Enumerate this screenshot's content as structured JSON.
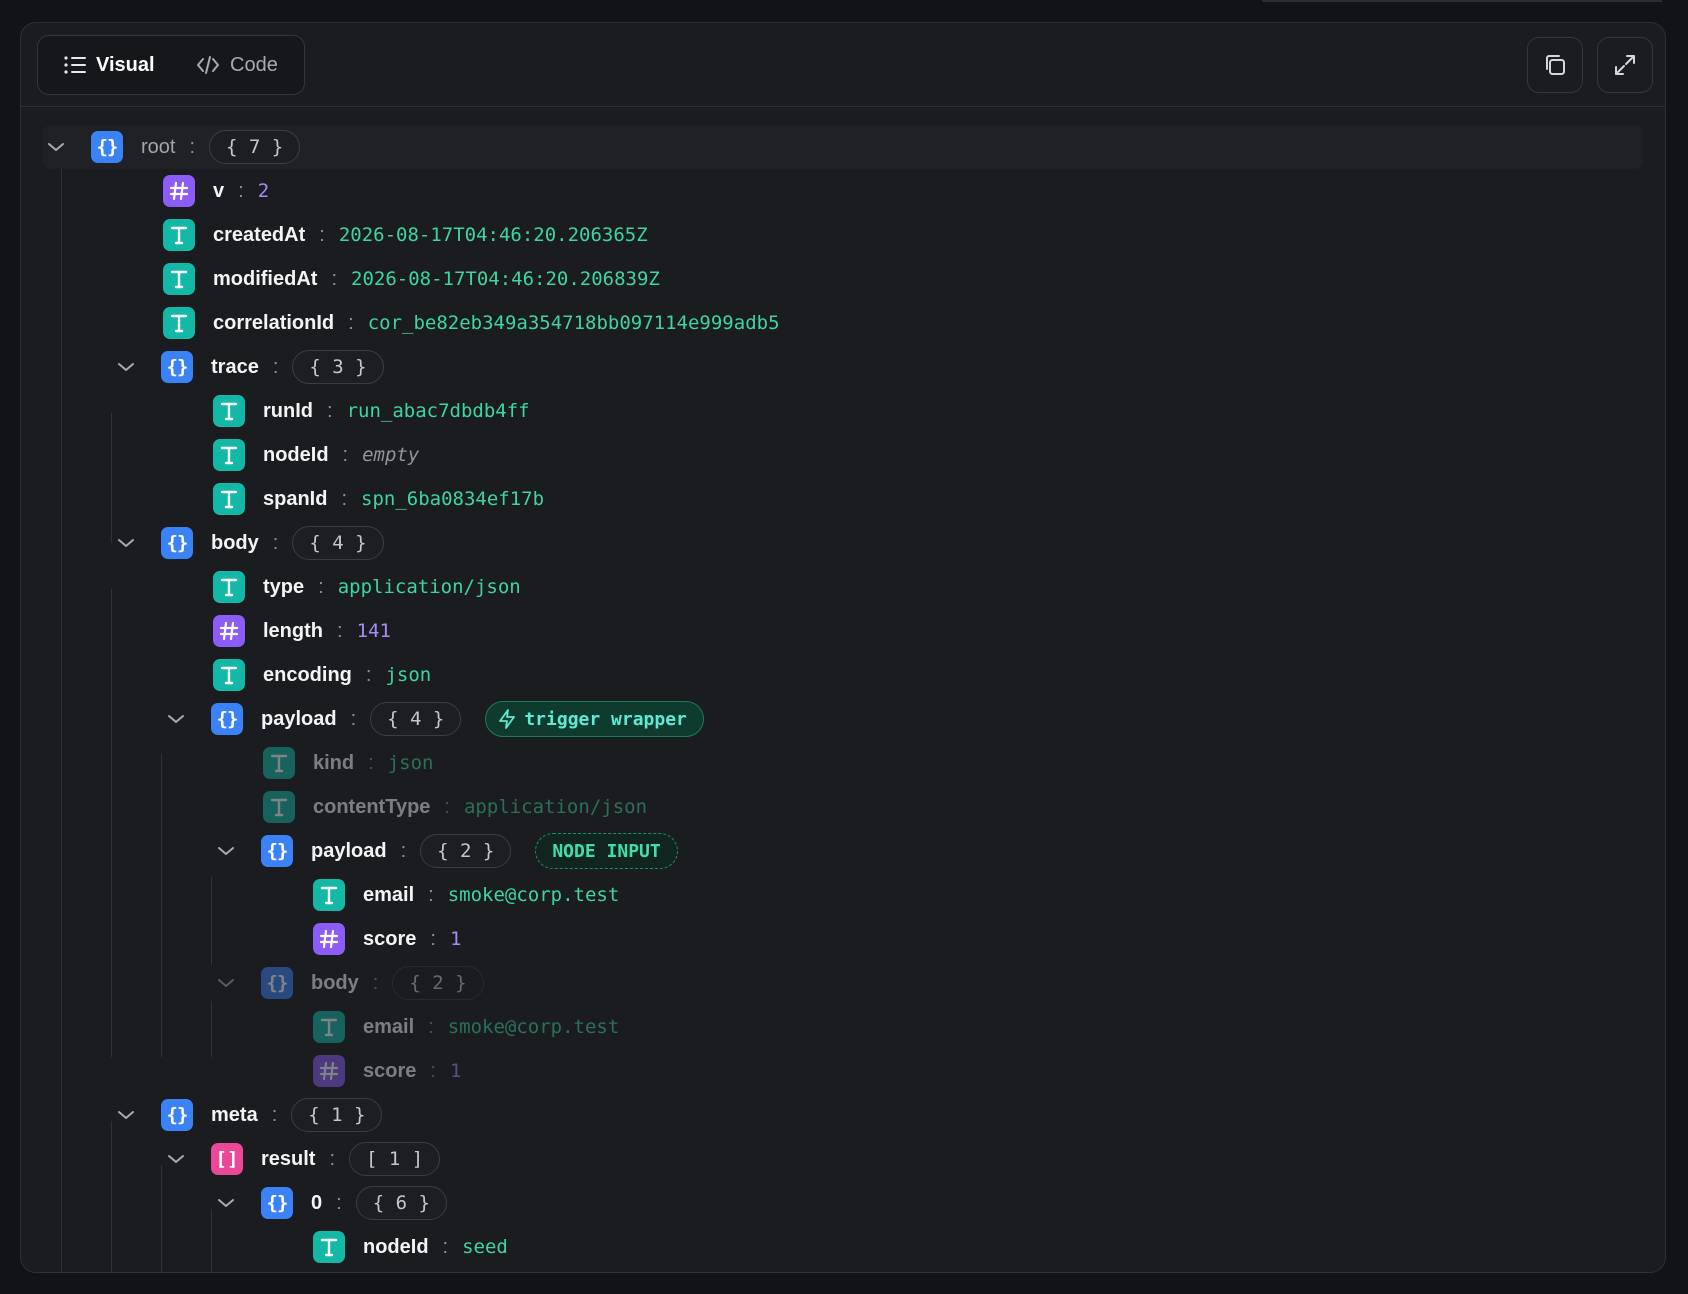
{
  "toolbar": {
    "visual_label": "Visual",
    "code_label": "Code",
    "copy_icon": "copy-icon",
    "expand_icon": "expand-icon"
  },
  "colors": {
    "object": "#3b82f6",
    "string": "#14b8a6",
    "number": "#8b5cf6",
    "array": "#ec4899",
    "string_value": "#3dd5a0",
    "number_value": "#a78bfa"
  },
  "tree": {
    "root": {
      "key": "root",
      "count": "{ 7 }"
    },
    "v": {
      "key": "v",
      "value": "2"
    },
    "createdAt": {
      "key": "createdAt",
      "value": "2026-08-17T04:46:20.206365Z"
    },
    "modifiedAt": {
      "key": "modifiedAt",
      "value": "2026-08-17T04:46:20.206839Z"
    },
    "correlationId": {
      "key": "correlationId",
      "value": "cor_be82eb349a354718bb097114e999adb5"
    },
    "trace": {
      "key": "trace",
      "count": "{ 3 }",
      "runId": {
        "key": "runId",
        "value": "run_abac7dbdb4ff"
      },
      "nodeId": {
        "key": "nodeId",
        "value": "empty"
      },
      "spanId": {
        "key": "spanId",
        "value": "spn_6ba0834ef17b"
      }
    },
    "body": {
      "key": "body",
      "count": "{ 4 }",
      "type": {
        "key": "type",
        "value": "application/json"
      },
      "length": {
        "key": "length",
        "value": "141"
      },
      "encoding": {
        "key": "encoding",
        "value": "json"
      },
      "payload": {
        "key": "payload",
        "count": "{ 4 }",
        "badge": "trigger wrapper",
        "kind": {
          "key": "kind",
          "value": "json"
        },
        "contentType": {
          "key": "contentType",
          "value": "application/json"
        },
        "payload": {
          "key": "payload",
          "count": "{ 2 }",
          "badge": "NODE INPUT",
          "email": {
            "key": "email",
            "value": "smoke@corp.test"
          },
          "score": {
            "key": "score",
            "value": "1"
          }
        },
        "body": {
          "key": "body",
          "count": "{ 2 }",
          "email": {
            "key": "email",
            "value": "smoke@corp.test"
          },
          "score": {
            "key": "score",
            "value": "1"
          }
        }
      }
    },
    "meta": {
      "key": "meta",
      "count": "{ 1 }",
      "result": {
        "key": "result",
        "count": "[ 1 ]",
        "item0": {
          "key": "0",
          "count": "{ 6 }",
          "nodeId": {
            "key": "nodeId",
            "value": "seed"
          }
        }
      }
    }
  }
}
